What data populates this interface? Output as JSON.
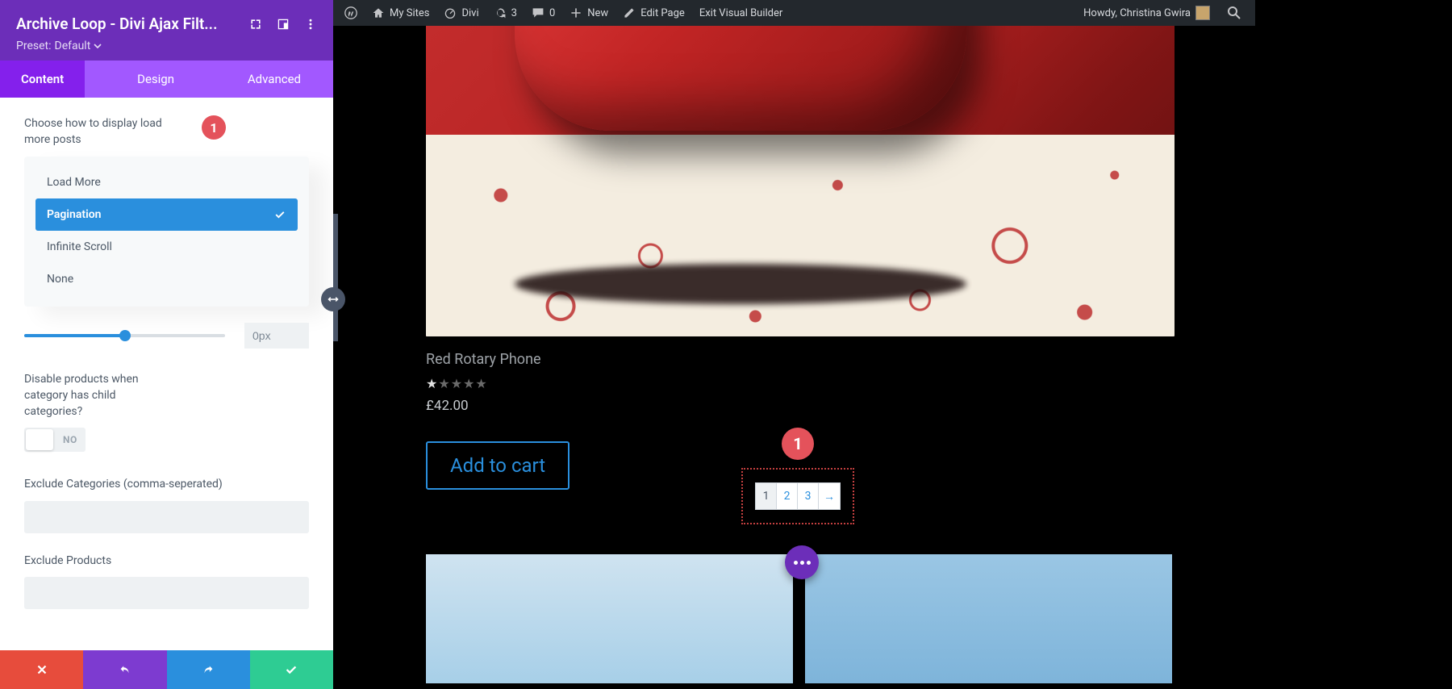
{
  "adminbar": {
    "mysites": "My Sites",
    "site": "Divi",
    "updates": "3",
    "comments": "0",
    "new": "New",
    "edit": "Edit Page",
    "exit": "Exit Visual Builder",
    "howdy": "Howdy, Christina Gwira"
  },
  "panel": {
    "title": "Archive Loop - Divi Ajax Filt...",
    "preset_label": "Preset:",
    "preset_value": "Default",
    "tabs": {
      "content": "Content",
      "design": "Design",
      "advanced": "Advanced"
    },
    "display_label": "Choose how to display load more posts",
    "step": "1",
    "options": {
      "load_more": "Load More",
      "pagination": "Pagination",
      "infinite": "Infinite Scroll",
      "none": "None"
    },
    "slider_value": "0px",
    "disable_label": "Disable products when category has child categories?",
    "toggle_state": "NO",
    "exclude_cat": "Exclude Categories (comma-seperated)",
    "exclude_prod": "Exclude Products"
  },
  "product": {
    "title": "Red Rotary Phone",
    "price": "£42.00",
    "cart": "Add to cart"
  },
  "callout": "1",
  "pagination": {
    "p1": "1",
    "p2": "2",
    "p3": "3",
    "next": "→"
  },
  "colors": {
    "purple_dark": "#6c2eb9",
    "purple_light": "#a258ff",
    "purple_active": "#8420ec",
    "blue": "#2a8fdd",
    "red_badge": "#e4525b",
    "green": "#2ecc93"
  }
}
